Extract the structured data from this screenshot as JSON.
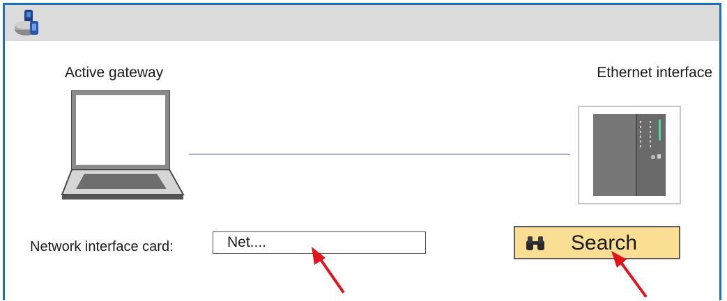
{
  "diagram": {
    "gateway_label": "Active gateway",
    "ethernet_label": "Ethernet interface"
  },
  "form": {
    "nic_label": "Network interface card:",
    "nic_value": "Net...."
  },
  "toolbar": {
    "search_label": "Search"
  },
  "colors": {
    "window_border": "#1a72b8",
    "titlebar": "#dcdcdc",
    "search_button_bg": "#f9de94",
    "annotation_arrow": "#e0141a"
  },
  "icons": {
    "app": "network-app-icon",
    "search": "binoculars-icon"
  }
}
